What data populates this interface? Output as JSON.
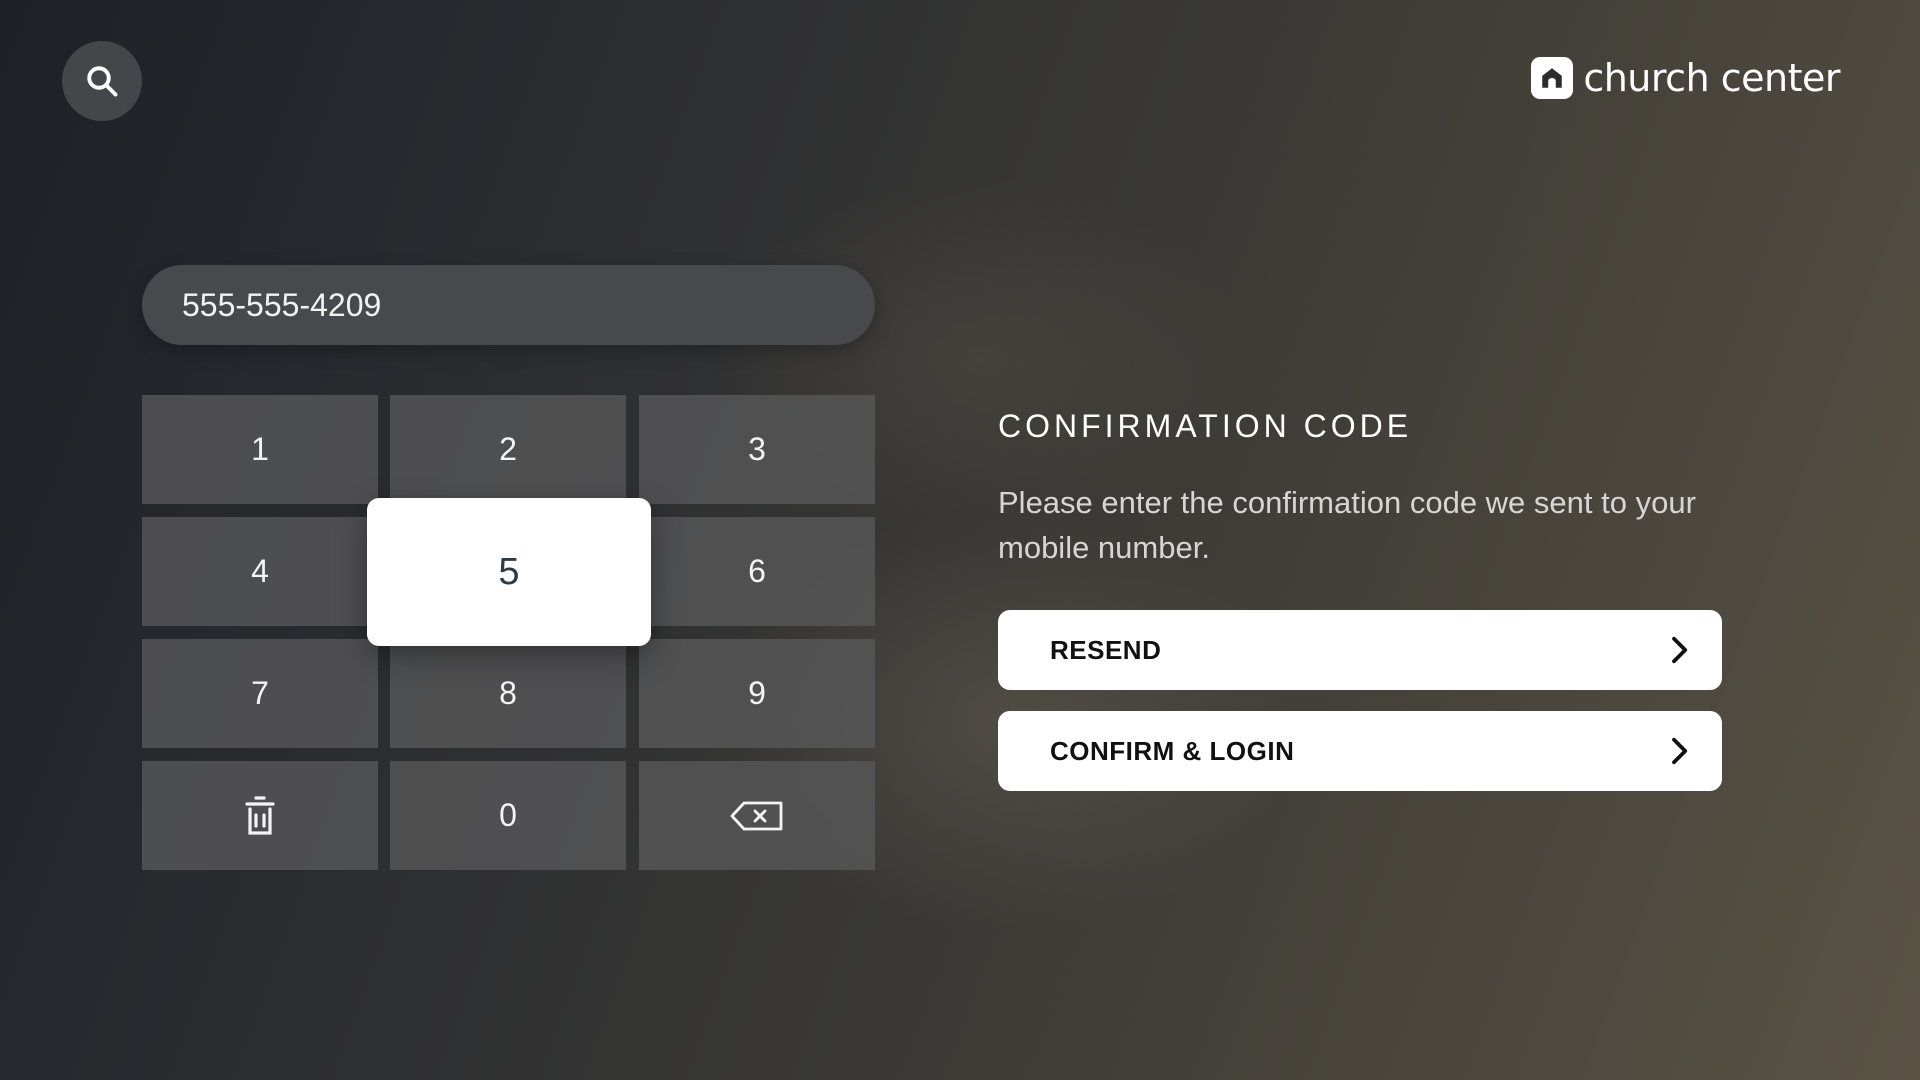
{
  "header": {
    "search_icon": "search-icon",
    "logo": {
      "icon": "home-icon",
      "text": "church center"
    }
  },
  "phone_input": {
    "value": "555-555-4209"
  },
  "keypad": {
    "keys": [
      {
        "label": "1"
      },
      {
        "label": "2"
      },
      {
        "label": "3"
      },
      {
        "label": "4"
      },
      {
        "label": "5",
        "focused": true
      },
      {
        "label": "6"
      },
      {
        "label": "7"
      },
      {
        "label": "8"
      },
      {
        "label": "9"
      },
      {
        "label": "",
        "icon": "trash-icon"
      },
      {
        "label": "0"
      },
      {
        "label": "",
        "icon": "backspace-icon"
      }
    ]
  },
  "confirmation": {
    "heading": "CONFIRMATION CODE",
    "description": "Please enter the confirmation code we sent to your  mobile number.",
    "resend_label": "RESEND",
    "confirm_label": "CONFIRM & LOGIN"
  },
  "colors": {
    "button_bg": "#ffffff",
    "button_text": "#111111",
    "focused_key_text": "#2f3a45"
  }
}
